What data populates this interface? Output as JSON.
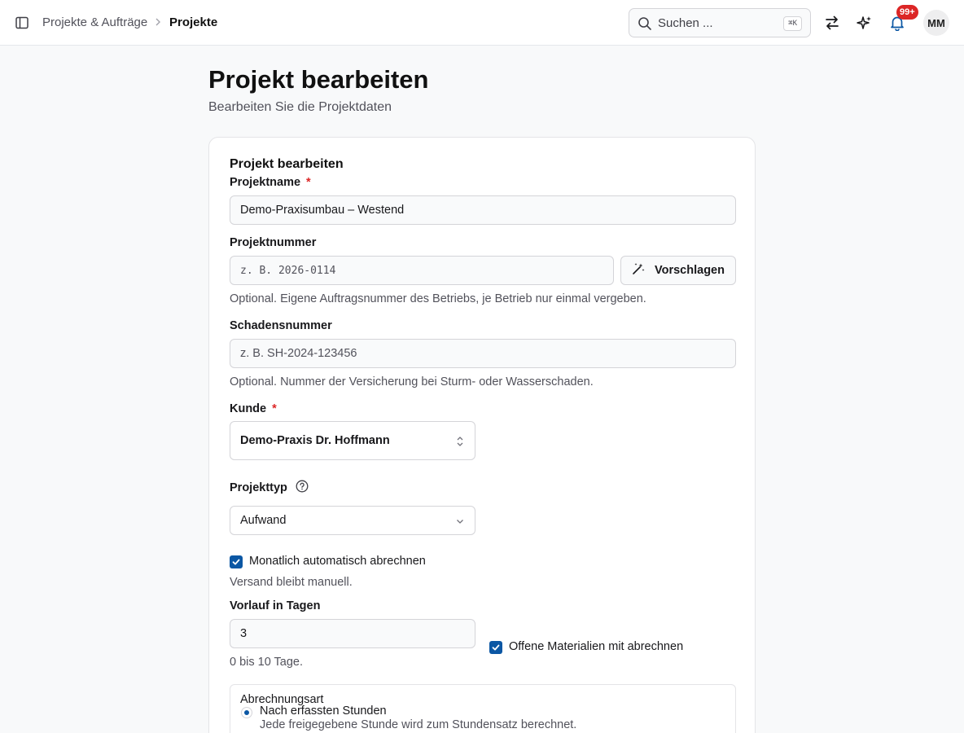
{
  "header": {
    "breadcrumb": {
      "parent": "Projekte & Aufträge",
      "current": "Projekte"
    },
    "search": {
      "placeholder": "Suchen ...",
      "shortcut": "⌘K"
    },
    "notifications": {
      "count": "99+"
    },
    "avatar": {
      "initials": "MM"
    }
  },
  "page": {
    "title": "Projekt bearbeiten",
    "subtitle": "Bearbeiten Sie die Projektdaten"
  },
  "form": {
    "title": "Projekt bearbeiten",
    "projektname": {
      "label": "Projektname",
      "required": "*",
      "value": "Demo-Praxisumbau – Westend"
    },
    "projektnummer": {
      "label": "Projektnummer",
      "placeholder": "z. B. 2026-0114",
      "suggest_label": "Vorschlagen",
      "help": "Optional. Eigene Auftragsnummer des Betriebs, je Betrieb nur einmal vergeben."
    },
    "schadensnummer": {
      "label": "Schadensnummer",
      "placeholder": "z. B. SH-2024-123456",
      "help": "Optional. Nummer der Versicherung bei Sturm- oder Wasserschaden."
    },
    "kunde": {
      "label": "Kunde",
      "required": "*",
      "value": "Demo-Praxis Dr. Hoffmann"
    },
    "projekttyp": {
      "label": "Projekttyp",
      "value": "Aufwand"
    },
    "auto_billing": {
      "label": "Monatlich automatisch abrechnen",
      "checked": true,
      "help": "Versand bleibt manuell."
    },
    "vorlauf": {
      "label": "Vorlauf in Tagen",
      "value": "3",
      "help": "0 bis 10 Tage."
    },
    "materials": {
      "label": "Offene Materialien mit abrechnen",
      "checked": true
    },
    "abrechnungsart": {
      "legend": "Abrechnungsart",
      "options": [
        {
          "label": "Nach erfassten Stunden",
          "description": "Jede freigegebene Stunde wird zum Stundensatz berechnet.",
          "selected": true
        }
      ]
    }
  },
  "colors": {
    "accent": "#0b57a4",
    "required": "#dc2626",
    "badge": "#dc2626"
  }
}
